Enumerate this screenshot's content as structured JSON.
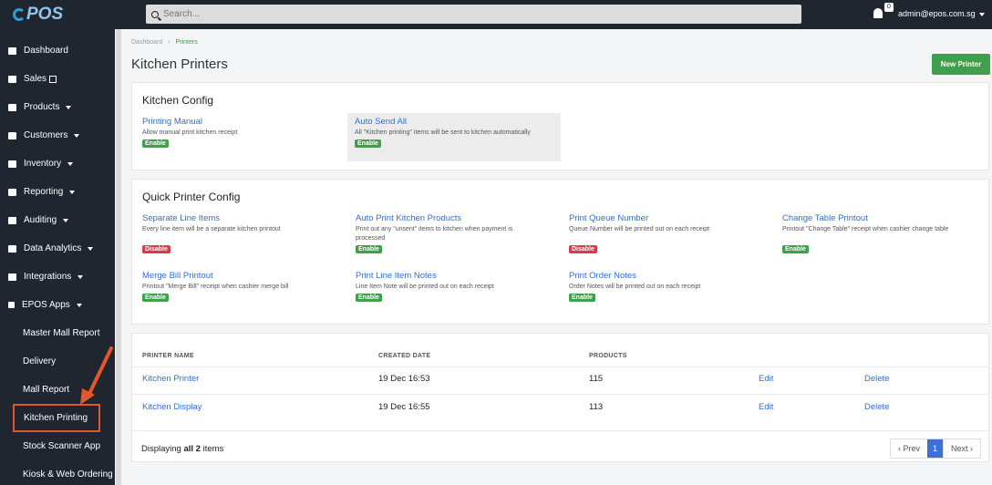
{
  "app": {
    "logo": "POS"
  },
  "search": {
    "placeholder": "Search..."
  },
  "user": {
    "notifications": "0",
    "email": "admin@epos.com.sg"
  },
  "sidebar": {
    "items": [
      {
        "label": "Dashboard",
        "icon": "dashboard-icon"
      },
      {
        "label": "Sales",
        "icon": "cart-icon"
      },
      {
        "label": "Products",
        "icon": "box-icon"
      },
      {
        "label": "Customers",
        "icon": "users-icon"
      },
      {
        "label": "Inventory",
        "icon": "inventory-icon"
      },
      {
        "label": "Reporting",
        "icon": "chart-icon"
      },
      {
        "label": "Auditing",
        "icon": "file-icon"
      },
      {
        "label": "Data Analytics",
        "icon": "analytics-icon"
      },
      {
        "label": "Integrations",
        "icon": "plug-icon"
      },
      {
        "label": "EPOS Apps",
        "icon": "plus-icon"
      }
    ],
    "sub_items": [
      {
        "label": "Master Mall Report"
      },
      {
        "label": "Delivery"
      },
      {
        "label": "Mall Report"
      },
      {
        "label": "Kitchen Printing"
      },
      {
        "label": "Stock Scanner App"
      },
      {
        "label": "Kiosk & Web Ordering"
      }
    ]
  },
  "breadcrumb": {
    "root": "Dashboard",
    "sep": "›",
    "current": "Printers"
  },
  "page": {
    "title": "Kitchen Printers",
    "new_button": "New Printer"
  },
  "kitchen_config": {
    "title": "Kitchen Config",
    "items": [
      {
        "title": "Printing Manual",
        "desc": "Allow manual print kitchen receipt",
        "status": "Enable"
      },
      {
        "title": "Auto Send All",
        "desc": "All \"Kitchen printing\" items will be sent to kitchen automatically",
        "status": "Enable"
      }
    ]
  },
  "quick_config": {
    "title": "Quick Printer Config",
    "items": [
      {
        "title": "Separate Line Items",
        "desc": "Every line item will be a separate kitchen printout",
        "status": "Disable"
      },
      {
        "title": "Auto Print Kitchen Products",
        "desc": "Print out any \"unsent\" items to kitchen when payment is processed",
        "status": "Enable"
      },
      {
        "title": "Print Queue Number",
        "desc": "Queue Number will be printed out on each receipt",
        "status": "Disable"
      },
      {
        "title": "Change Table Printout",
        "desc": "Printout \"Change Table\" receipt when cashier change table",
        "status": "Enable"
      },
      {
        "title": "Merge Bill Printout",
        "desc": "Printout \"Merge Bill\" receipt when cashier merge bill",
        "status": "Enable"
      },
      {
        "title": "Print Line Item Notes",
        "desc": "Line Item Note will be printed out on each receipt",
        "status": "Enable"
      },
      {
        "title": "Print Order Notes",
        "desc": "Order Notes will be printed out on each receipt",
        "status": "Enable"
      }
    ]
  },
  "table": {
    "headers": [
      "PRINTER NAME",
      "CREATED DATE",
      "PRODUCTS"
    ],
    "rows": [
      {
        "name": "Kitchen Printer",
        "date": "19 Dec 16:53",
        "products": "115",
        "edit": "Edit",
        "delete": "Delete"
      },
      {
        "name": "Kitchen Display",
        "date": "19 Dec 16:55",
        "products": "113",
        "edit": "Edit",
        "delete": "Delete"
      }
    ],
    "footer_prefix": "Displaying",
    "footer_count": "all 2",
    "footer_suffix": "items"
  },
  "pagination": {
    "prev": "‹ Prev",
    "current": "1",
    "next": "Next ›"
  },
  "colors": {
    "sidebar": "#1f262f",
    "accent_green": "#3ea04b",
    "link_blue": "#2f6fd6",
    "disable_red": "#d23f49",
    "highlight_orange": "#e4572e"
  }
}
